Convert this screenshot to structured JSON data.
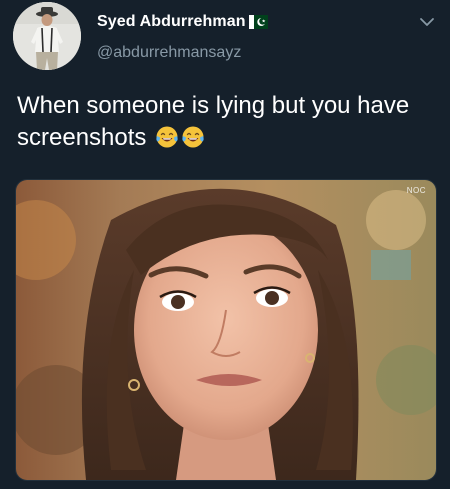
{
  "tweet": {
    "display_name": "Syed Abdurrehman",
    "handle": "@abdurrehmansayz",
    "text": "When someone is lying but you have screenshots",
    "emojis": [
      "face-with-tears-of-joy-icon",
      "face-with-tears-of-joy-icon"
    ]
  },
  "media": {
    "watermark": "NOC"
  },
  "colors": {
    "background": "#15202b",
    "text": "#ffffff",
    "handle": "#8899a6",
    "flag_green": "#01411c"
  }
}
